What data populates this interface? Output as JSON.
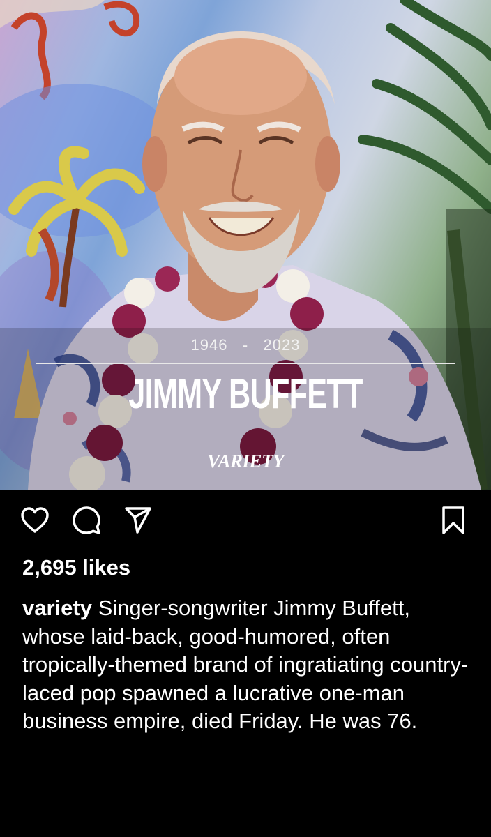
{
  "post": {
    "overlay": {
      "birth_year": "1946",
      "separator": "-",
      "death_year": "2023",
      "name": "JIMMY BUFFETT",
      "brand": "VARIETY"
    },
    "actions": {
      "like_icon": "heart-icon",
      "comment_icon": "comment-icon",
      "share_icon": "send-icon",
      "save_icon": "bookmark-icon"
    },
    "likes": "2,695 likes",
    "caption": {
      "username": "variety",
      "text": "Singer-songwriter Jimmy Buffett, whose laid-back, good-humored, often tropically-themed brand of ingratiating country-laced pop spawned a lucrative one-man business empire, died Friday. He was 76."
    }
  }
}
